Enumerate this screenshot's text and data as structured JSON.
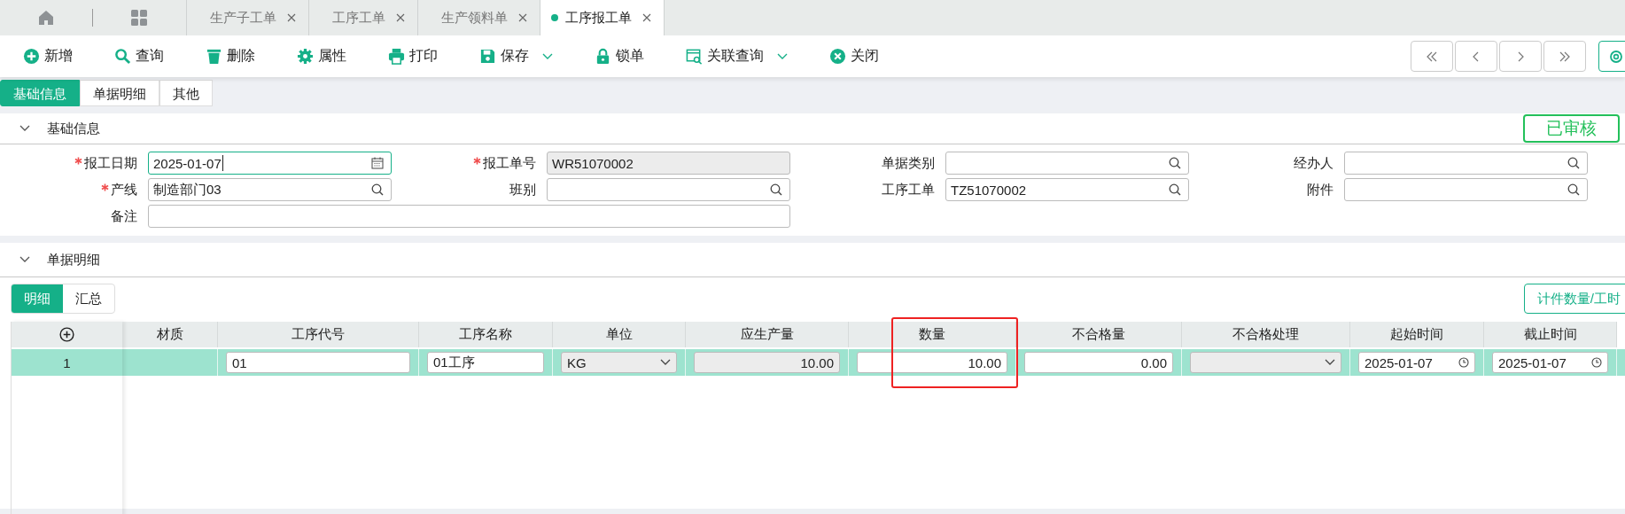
{
  "top_tabs": [
    {
      "label": "生产子工单",
      "selected": false
    },
    {
      "label": "工序工单",
      "selected": false
    },
    {
      "label": "生产领料单",
      "selected": false
    },
    {
      "label": "工序报工单",
      "selected": true
    }
  ],
  "toolbar": [
    {
      "kind": "plus",
      "label": "新增",
      "dropdown": false
    },
    {
      "kind": "search",
      "label": "查询",
      "dropdown": false
    },
    {
      "kind": "trash",
      "label": "删除",
      "dropdown": false
    },
    {
      "kind": "gear",
      "label": "属性",
      "dropdown": false
    },
    {
      "kind": "printer",
      "label": "打印",
      "dropdown": false
    },
    {
      "kind": "save",
      "label": "保存",
      "dropdown": true
    },
    {
      "kind": "lock",
      "label": "锁单",
      "dropdown": false
    },
    {
      "kind": "related",
      "label": "关联查询",
      "dropdown": true
    },
    {
      "kind": "close",
      "label": "关闭",
      "dropdown": false
    }
  ],
  "page_tabs": [
    {
      "label": "基础信息",
      "selected": true
    },
    {
      "label": "单据明细",
      "selected": false
    },
    {
      "label": "其他",
      "selected": false
    }
  ],
  "basic_section": {
    "title": "基础信息",
    "status": "已审核",
    "fields": [
      {
        "label": "报工日期",
        "required": true,
        "value": "2025-01-07",
        "kind": "date",
        "readonly": false,
        "focused": true,
        "wide": false
      },
      {
        "label": "报工单号",
        "required": true,
        "value": "WR51070002",
        "kind": "plain",
        "readonly": true,
        "focused": false,
        "wide": false
      },
      {
        "label": "单据类别",
        "required": false,
        "kind": "lookup",
        "readonly": false,
        "focused": false,
        "wide": false
      },
      {
        "label": "经办人",
        "required": false,
        "kind": "lookup",
        "readonly": false,
        "focused": false,
        "wide": false
      },
      {
        "label": "产线",
        "required": true,
        "value": "制造部门03",
        "kind": "lookup",
        "readonly": false,
        "focused": false,
        "wide": false
      },
      {
        "label": "班别",
        "required": false,
        "kind": "lookup",
        "readonly": false,
        "focused": false,
        "wide": false
      },
      {
        "label": "工序工单",
        "required": false,
        "value": "TZ51070002",
        "kind": "lookup",
        "readonly": false,
        "focused": false,
        "wide": false
      },
      {
        "label": "附件",
        "required": false,
        "kind": "lookup",
        "readonly": false,
        "focused": false,
        "wide": false
      },
      {
        "label": "备注",
        "required": false,
        "kind": "plain",
        "readonly": false,
        "focused": false,
        "wide": true
      }
    ]
  },
  "detail_section": {
    "title": "单据明细",
    "sub_tabs": [
      {
        "label": "明细",
        "selected": true
      },
      {
        "label": "汇总",
        "selected": false
      }
    ],
    "action_button": "计件数量/工时",
    "columns": [
      {
        "label": "材质",
        "highlighted": false
      },
      {
        "label": "工序代号",
        "highlighted": false
      },
      {
        "label": "工序名称",
        "highlighted": false
      },
      {
        "label": "单位",
        "highlighted": false
      },
      {
        "label": "应生产量",
        "highlighted": false
      },
      {
        "label": "数量",
        "highlighted": true
      },
      {
        "label": "不合格量",
        "highlighted": false
      },
      {
        "label": "不合格处理",
        "highlighted": false
      },
      {
        "label": "起始时间",
        "highlighted": false
      },
      {
        "label": "截止时间",
        "highlighted": false
      }
    ],
    "rows": [
      {
        "index": "1",
        "selected": true,
        "cells": [
          {
            "kind": "blank"
          },
          {
            "kind": "text",
            "value": "01"
          },
          {
            "kind": "text",
            "value": "01工序"
          },
          {
            "kind": "select",
            "value": "KG"
          },
          {
            "kind": "readonly-number",
            "value": "10.00"
          },
          {
            "kind": "number",
            "value": "10.00"
          },
          {
            "kind": "number",
            "value": "0.00"
          },
          {
            "kind": "select"
          },
          {
            "kind": "date",
            "value": "2025-01-07"
          },
          {
            "kind": "date",
            "value": "2025-01-07"
          }
        ]
      }
    ]
  }
}
